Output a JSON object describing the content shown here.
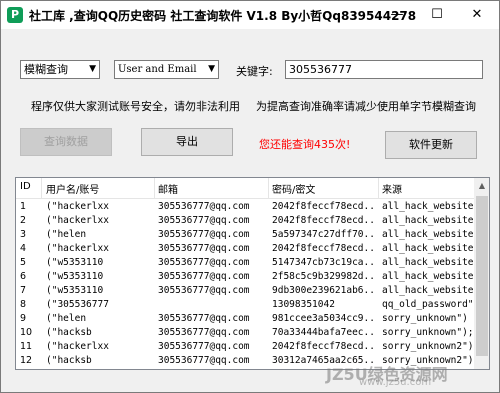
{
  "window": {
    "title": "社工库 ,查询QQ历史密码 社工查询软件 V1.8   By小哲Qq839544278",
    "icon_glyph": "P",
    "minimize": "—",
    "maximize": "☐",
    "close": "✕"
  },
  "search": {
    "mode_value": "模糊查询",
    "field_value": "User and Email",
    "keyword_label": "关键字:",
    "keyword_value": "305536777"
  },
  "notes": {
    "left": "程序仅供大家测试账号安全，请勿非法利用",
    "right": "为提高查询准确率请减少使用单字节模糊查询"
  },
  "buttons": {
    "query": "查询数据",
    "export": "导出",
    "update": "软件更新"
  },
  "remaining_text": "您还能查询435次!",
  "table": {
    "columns": [
      "ID",
      "用户名/账号",
      "邮箱",
      "密码/密文",
      "来源"
    ],
    "rows": [
      [
        "1",
        "(\"hackerlxx",
        "305536777@qq.com",
        "2042f8feccf78ecd...",
        "all_hack_website\")"
      ],
      [
        "2",
        "(\"hackerlxx",
        "305536777@qq.com",
        "2042f8feccf78ecd...",
        "all_hack_website\")"
      ],
      [
        "3",
        "(\"helen",
        "305536777@qq.com",
        "5a597347c27dff70...",
        "all_hack_website\")"
      ],
      [
        "4",
        "(\"hackerlxx",
        "305536777@qq.com",
        "2042f8feccf78ecd...",
        "all_hack_website\")"
      ],
      [
        "5",
        "(\"w5353110",
        "305536777@qq.com",
        "5147347cb73c19ca...",
        "all_hack_website\")"
      ],
      [
        "6",
        "(\"w5353110",
        "305536777@qq.com",
        "2f58c5c9b329982d...",
        "all_hack_website\")"
      ],
      [
        "7",
        "(\"w5353110",
        "305536777@qq.com",
        "9db300e239621ab6...",
        "all_hack_website\")"
      ],
      [
        "8",
        "(\"305536777",
        "",
        "13098351042",
        "qq_old_password\");"
      ],
      [
        "9",
        "(\"helen",
        "305536777@qq.com",
        "981ccee3a5034cc9...",
        "sorry_unknown\")"
      ],
      [
        "10",
        "(\"hacksb",
        "305536777@qq.com",
        "70a33444bafa7eec...",
        "sorry_unknown\");"
      ],
      [
        "11",
        "(\"hackerlxx",
        "305536777@qq.com",
        "2042f8feccf78ecd...",
        "sorry_unknown2\")"
      ],
      [
        "12",
        "(\"hacksb",
        "305536777@qq.com",
        "30312a7465aa2c65...",
        "sorry_unknown2\")"
      ]
    ]
  },
  "watermark": {
    "main": "JZ5U绿色资源网",
    "sub": "www.jz5u.com"
  },
  "colors": {
    "accent_icon": "#0f9d58",
    "remaining_text": "#ff0000"
  }
}
